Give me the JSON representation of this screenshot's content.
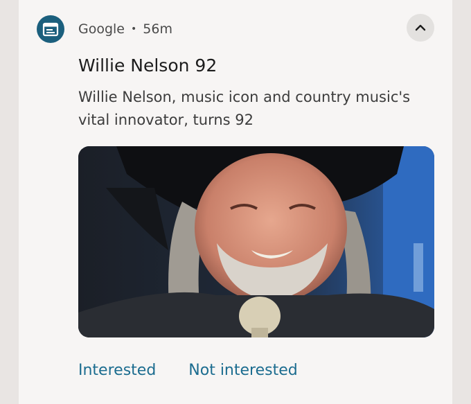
{
  "notification": {
    "app_icon": "calendar-icon",
    "app_name": "Google",
    "separator": "•",
    "time": "56m",
    "expand_icon": "chevron-up-icon",
    "title": "Willie Nelson 92",
    "body_line1": "Willie Nelson, music icon and country music's",
    "body_line2": "vital innovator, turns 92",
    "actions": [
      {
        "label": "Interested"
      },
      {
        "label": "Not interested"
      }
    ],
    "colors": {
      "accent": "#1b6c8f",
      "icon_background": "#1b5f7d",
      "card_background": "#f7f5f4",
      "page_background": "#e9e5e3"
    }
  }
}
